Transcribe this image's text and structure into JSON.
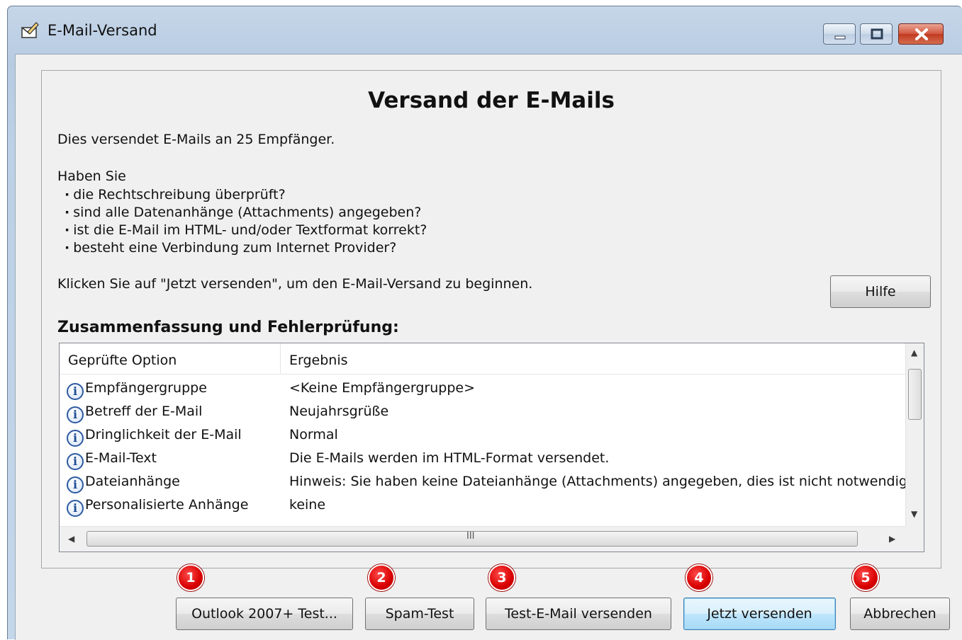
{
  "window": {
    "title": "E-Mail-Versand",
    "controls": [
      "minimize",
      "maximize",
      "close"
    ]
  },
  "dialog": {
    "heading": "Versand der E-Mails",
    "intro": "Dies versendet E-Mails an 25 Empfänger.",
    "question": "Haben Sie",
    "checklist": [
      "die Rechtschreibung überprüft?",
      "sind alle Datenanhänge (Attachments) angegeben?",
      "ist die E-Mail im HTML- und/oder Textformat korrekt?",
      "besteht eine Verbindung zum Internet Provider?"
    ],
    "instruction": "Klicken Sie auf \"Jetzt versenden\", um den E-Mail-Versand zu beginnen.",
    "help_button": "Hilfe",
    "summary_heading": "Zusammenfassung und Fehlerprüfung:"
  },
  "summary_table": {
    "columns": [
      "Geprüfte Option",
      "Ergebnis"
    ],
    "rows": [
      {
        "icon": "info-icon",
        "option": "Empfängergruppe",
        "result": "<Keine Empfängergruppe>"
      },
      {
        "icon": "info-icon",
        "option": "Betreff der E-Mail",
        "result": "Neujahrsgrüße"
      },
      {
        "icon": "info-icon",
        "option": "Dringlichkeit der E-Mail",
        "result": "Normal"
      },
      {
        "icon": "info-icon",
        "option": "E-Mail-Text",
        "result": "Die E-Mails werden im HTML-Format versendet."
      },
      {
        "icon": "info-icon",
        "option": "Dateianhänge",
        "result": "Hinweis: Sie haben keine Dateianhänge (Attachments) angegeben, dies ist nicht notwendig."
      },
      {
        "icon": "info-icon",
        "option": "Personalisierte Anhänge",
        "result": "keine"
      }
    ],
    "hscroll_grip": "III"
  },
  "buttons": [
    {
      "badge": "1",
      "label": "Outlook 2007+ Test..."
    },
    {
      "badge": "2",
      "label": "Spam-Test"
    },
    {
      "badge": "3",
      "label": "Test-E-Mail versenden"
    },
    {
      "badge": "4",
      "label": "Jetzt versenden"
    },
    {
      "badge": "5",
      "label": "Abbrechen"
    }
  ],
  "colors": {
    "badge": "#d80000",
    "default_button": "#bee6fd",
    "window_frame": "#b7cbe2",
    "close_button": "#c0391f"
  }
}
